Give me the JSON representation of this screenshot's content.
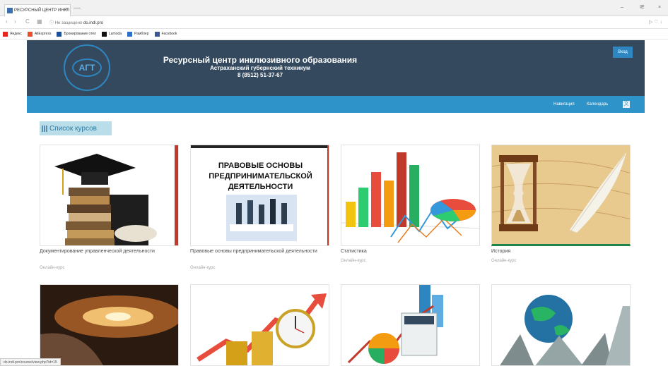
{
  "browser": {
    "tab_title": "РЕСУРСНЫЙ ЦЕНТР ИНКЛ",
    "tab_close": "×",
    "new_tab": "—",
    "url_prefix": "Не защищено",
    "url_domain": "do.indi.pro",
    "window_controls": [
      "–",
      "IE",
      "×"
    ]
  },
  "bookmarks": [
    {
      "label": "Яндекс",
      "color": "#e52620"
    },
    {
      "label": "AliExpress",
      "color": "#e8502b"
    },
    {
      "label": "Бронирование отел",
      "color": "#1f4e96"
    },
    {
      "label": "Lamoda",
      "color": "#111111"
    },
    {
      "label": "Рамблер",
      "color": "#2f6fca"
    },
    {
      "label": "Facebook",
      "color": "#3b5998"
    }
  ],
  "header": {
    "logo_text": "АГТ",
    "title": "Ресурсный центр инклюзивного образования",
    "subtitle": "Астраханский губернский техникум",
    "phone": "8 (8512) 51-37-67",
    "login_label": "Вход"
  },
  "nav": {
    "items": [
      "Навигация",
      "Календарь"
    ]
  },
  "section": {
    "heading": "Список курсов"
  },
  "courses": [
    {
      "title": "Документирование управленческой деятельности",
      "meta": "Онлайн-курс"
    },
    {
      "title": "Правовые основы предпринимательской деятельности",
      "meta": "Онлайн-курс",
      "image_text": "ПРАВОВЫЕ ОСНОВЫ ПРЕДПРИНИМАТЕЛЬСКОЙ ДЕЯТЕЛЬНОСТИ"
    },
    {
      "title": "Статистика",
      "meta": "Онлайн-курс"
    },
    {
      "title": "История",
      "meta": "Онлайн-курс"
    }
  ],
  "status_bar": "do.indi.pro/course/view.php?id=15",
  "colors": {
    "header_bg": "#34495e",
    "nav_strip": "#2e93c8",
    "accent": "#2e86c1",
    "heading_bg": "#b9dde9"
  }
}
